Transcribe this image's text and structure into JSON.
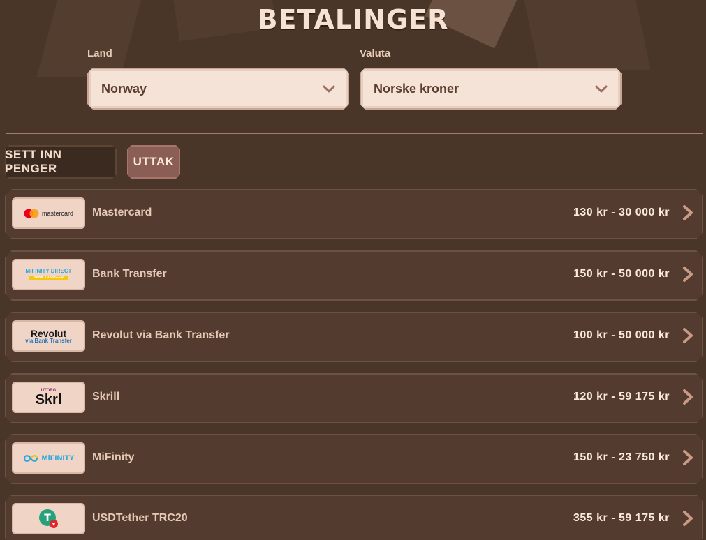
{
  "page": {
    "title": "BETALINGER"
  },
  "filters": {
    "country_label": "Land",
    "country_value": "Norway",
    "currency_label": "Valuta",
    "currency_value": "Norske kroner"
  },
  "tabs": [
    {
      "label": "SETT INN PENGER",
      "active": false
    },
    {
      "label": "UTTAK",
      "active": true
    }
  ],
  "methods": [
    {
      "logo": "mastercard",
      "logo_text": "mastercard",
      "name": "Mastercard",
      "range": "130 kr - 30 000 kr"
    },
    {
      "logo": "mifinity-direct",
      "logo_text": "MiFINITY DIRECT",
      "logo_sub": "BANK TRANSFER",
      "name": "Bank Transfer",
      "range": "150 kr - 50 000 kr"
    },
    {
      "logo": "revolut",
      "logo_text": "Revolut",
      "logo_sub": "via Bank Transfer",
      "name": "Revolut via Bank Transfer",
      "range": "100 kr - 50 000 kr"
    },
    {
      "logo": "skrill",
      "logo_text": "Skrl",
      "logo_sub": "UTORG",
      "name": "Skrill",
      "range": "120 kr - 59 175 kr"
    },
    {
      "logo": "mifinity",
      "logo_text": "MiFINITY",
      "name": "MiFinity",
      "range": "150 kr - 23 750 kr"
    },
    {
      "logo": "usdt-trc20",
      "logo_text": "T",
      "name": "USDTether TRC20",
      "range": "355 kr - 59 175 kr"
    }
  ],
  "colors": {
    "background": "#4a3529",
    "row": "#533c2f",
    "active_tab": "#8a5d55",
    "mastercard_red": "#eb001b",
    "mastercard_orange": "#f79e1b",
    "mifinity_blue": "#2aa7df",
    "mifinity_yellow": "#f5c518",
    "tether_green": "#26a17b",
    "tron_red": "#e2262d"
  }
}
